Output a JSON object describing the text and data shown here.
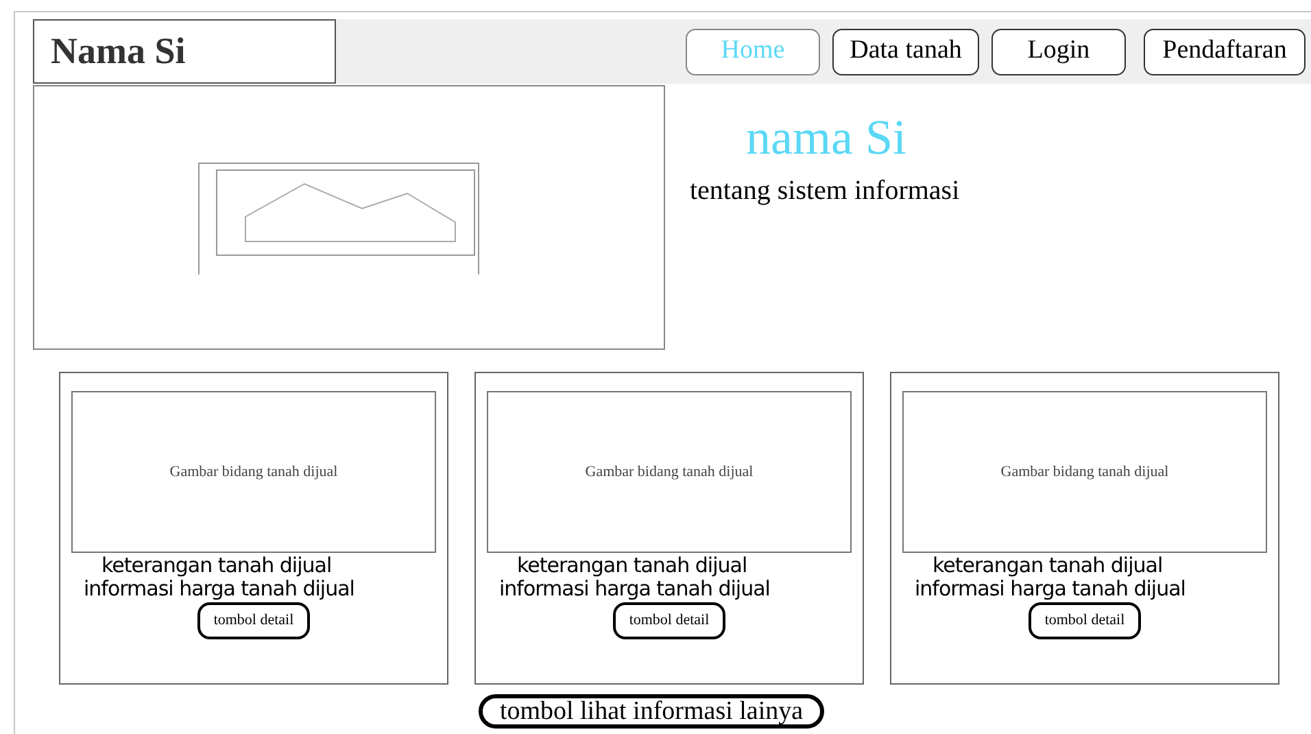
{
  "header": {
    "logo": "Nama Si",
    "nav": [
      {
        "label": "Home",
        "selected": true
      },
      {
        "label": "Data tanah",
        "selected": false
      },
      {
        "label": "Login",
        "selected": false
      },
      {
        "label": "Pendaftaran",
        "selected": false
      }
    ]
  },
  "hero": {
    "title": "nama Si",
    "subtitle": "tentang sistem informasi"
  },
  "cards": [
    {
      "image_label": "Gambar bidang tanah dijual",
      "description": "keterangan tanah dijual",
      "price": "informasi harga tanah dijual",
      "button": "tombol detail"
    },
    {
      "image_label": "Gambar bidang tanah dijual",
      "description": "keterangan tanah dijual",
      "price": "informasi harga tanah dijual",
      "button": "tombol detail"
    },
    {
      "image_label": "Gambar bidang tanah dijual",
      "description": "keterangan tanah dijual",
      "price": "informasi harga tanah dijual",
      "button": "tombol detail"
    }
  ],
  "more_button": "tombol lihat informasi lainya"
}
